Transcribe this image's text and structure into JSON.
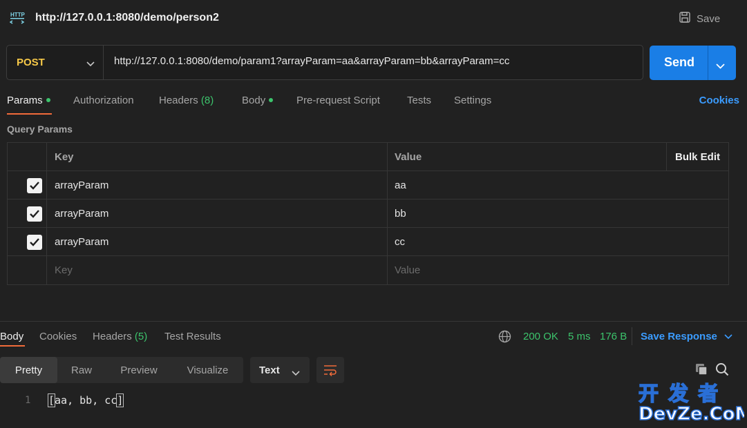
{
  "header": {
    "title": "http://127.0.0.1:8080/demo/person2",
    "save_label": "Save"
  },
  "request": {
    "method": "POST",
    "url": "http://127.0.0.1:8080/demo/param1?arrayParam=aa&arrayParam=bb&arrayParam=cc",
    "send_label": "Send"
  },
  "tabs": {
    "params": "Params",
    "authorization": "Authorization",
    "headers": "Headers",
    "headers_count": "(8)",
    "body": "Body",
    "prerequest": "Pre-request Script",
    "tests": "Tests",
    "settings": "Settings",
    "cookies": "Cookies"
  },
  "query_params": {
    "label": "Query Params",
    "key_header": "Key",
    "value_header": "Value",
    "bulk_edit": "Bulk Edit",
    "rows": [
      {
        "checked": true,
        "key": "arrayParam",
        "value": "aa"
      },
      {
        "checked": true,
        "key": "arrayParam",
        "value": "bb"
      },
      {
        "checked": true,
        "key": "arrayParam",
        "value": "cc"
      }
    ],
    "key_placeholder": "Key",
    "value_placeholder": "Value"
  },
  "response": {
    "tabs": {
      "body": "Body",
      "cookies": "Cookies",
      "headers": "Headers",
      "headers_count": "(5)",
      "test_results": "Test Results"
    },
    "status": "200 OK",
    "time": "5 ms",
    "size": "176 B",
    "save_response": "Save Response",
    "view_modes": [
      "Pretty",
      "Raw",
      "Preview",
      "Visualize"
    ],
    "format": "Text",
    "line_number": "1",
    "body_text": "aa, bb, cc",
    "open_bracket": "[",
    "close_bracket": "]"
  },
  "watermark": {
    "line1": "开 发 者",
    "line2": "DevZe.CoM"
  },
  "colors": {
    "accent": "#f26b3a",
    "send": "#1a7ee6",
    "link": "#3b9cff",
    "success": "#3cc46c",
    "method": "#f7c948"
  }
}
